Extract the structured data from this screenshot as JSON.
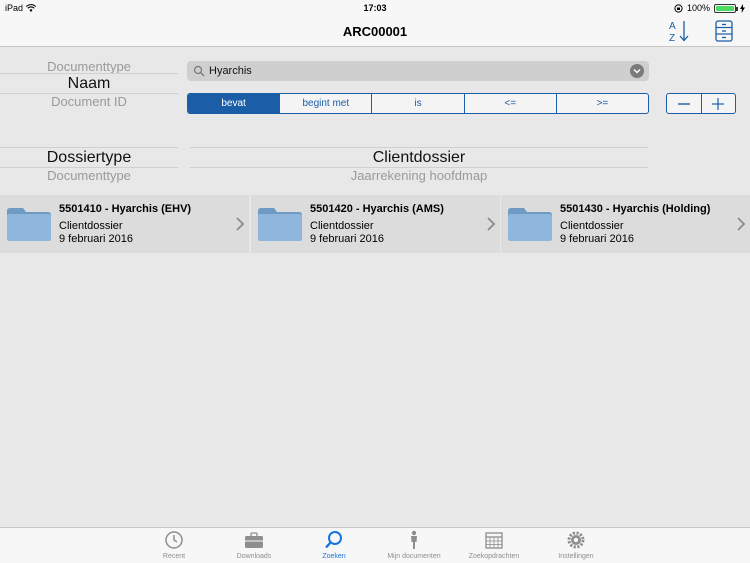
{
  "status": {
    "carrier": "iPad",
    "time": "17:03",
    "battery": "100%",
    "battery_level": 1.0
  },
  "nav": {
    "title": "ARC00001",
    "sort_icon": "sort-az-icon",
    "cabinet_icon": "file-cabinet-icon"
  },
  "field_picker": {
    "above": "Documenttype",
    "selected": "Naam",
    "below": "Document ID"
  },
  "search": {
    "value": "Hyarchis",
    "placeholder": ""
  },
  "operators": [
    {
      "label": "bevat",
      "active": true
    },
    {
      "label": "begint met",
      "active": false
    },
    {
      "label": "is",
      "active": false
    },
    {
      "label": "<=",
      "active": false
    },
    {
      "label": ">=",
      "active": false
    }
  ],
  "stepper": {
    "minus": "−",
    "plus": "+"
  },
  "type_picker": {
    "selected": "Dossiertype",
    "below": "Documenttype"
  },
  "dossier_picker": {
    "selected": "Clientdossier",
    "below": "Jaarrekening hoofdmap"
  },
  "results": [
    {
      "title": "5501410 - Hyarchis (EHV)",
      "type": "Clientdossier",
      "date": "9 februari 2016"
    },
    {
      "title": "5501420 - Hyarchis (AMS)",
      "type": "Clientdossier",
      "date": "9 februari 2016"
    },
    {
      "title": "5501430 - Hyarchis (Holding)",
      "type": "Clientdossier",
      "date": "9 februari 2016"
    }
  ],
  "tabs": [
    {
      "label": "Recent",
      "icon": "clock-icon",
      "active": false
    },
    {
      "label": "Downloads",
      "icon": "briefcase-icon",
      "active": false
    },
    {
      "label": "Zoeken",
      "icon": "search-icon",
      "active": true
    },
    {
      "label": "Mijn documenten",
      "icon": "person-icon",
      "active": false
    },
    {
      "label": "Zoekopdrachten",
      "icon": "calendar-icon",
      "active": false
    },
    {
      "label": "Instellingen",
      "icon": "gear-icon",
      "active": false
    }
  ],
  "colors": {
    "accent": "#1b5ea7",
    "tab_active": "#1a73d9",
    "folder": "#7fa8cf"
  }
}
